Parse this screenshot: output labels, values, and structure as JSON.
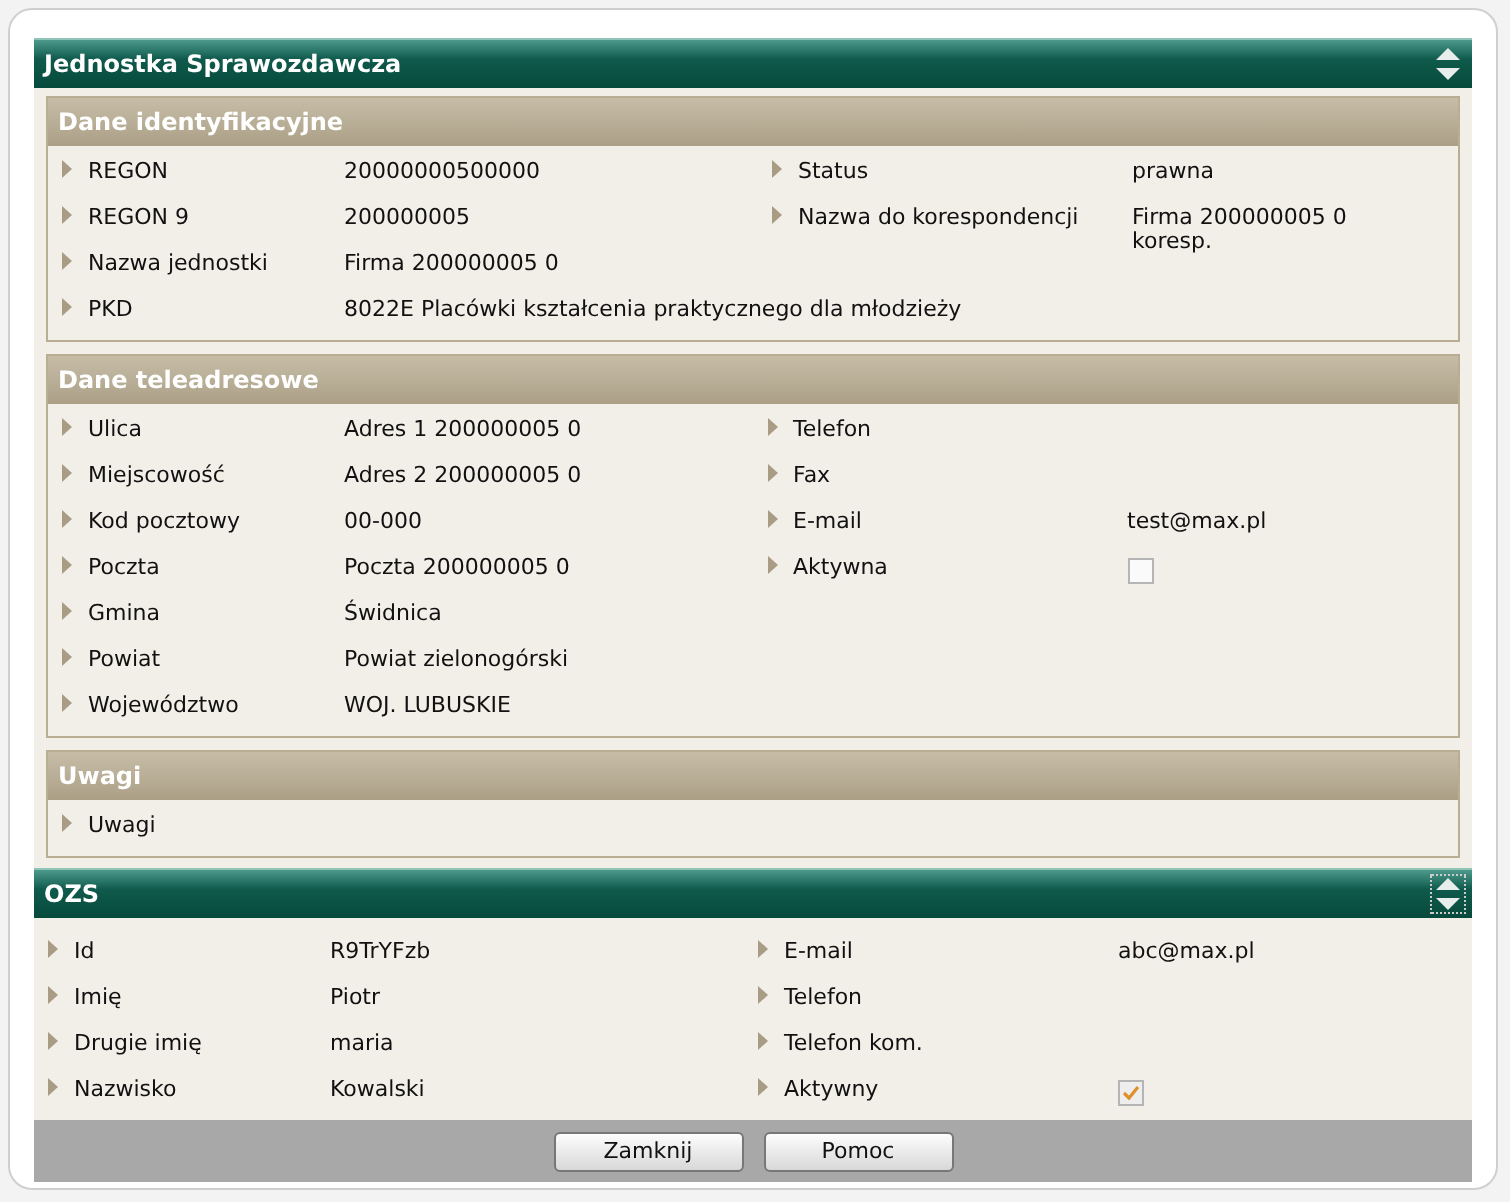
{
  "panels": [
    {
      "title": "Jednostka Sprawozdawcza",
      "sections": [
        {
          "title": "Dane identyfikacyjne",
          "left": [
            {
              "kind": "text",
              "label": "REGON",
              "value": "20000000500000"
            },
            {
              "kind": "text",
              "label": "REGON 9",
              "value": "200000005"
            },
            {
              "kind": "text",
              "label": "Nazwa jednostki",
              "value": "Firma 200000005 0"
            },
            {
              "kind": "text",
              "label": "PKD",
              "value": "8022E Placówki kształcenia praktycznego dla młodzieży"
            }
          ],
          "right": [
            {
              "kind": "text",
              "label": "Status",
              "value": "prawna"
            },
            {
              "kind": "text",
              "label": "Nazwa do korespondencji",
              "value": "Firma 200000005 0 koresp."
            }
          ]
        },
        {
          "title": "Dane teleadresowe",
          "left": [
            {
              "kind": "text",
              "label": "Ulica",
              "value": "Adres 1 200000005 0"
            },
            {
              "kind": "text",
              "label": "Miejscowość",
              "value": "Adres 2 200000005 0"
            },
            {
              "kind": "text",
              "label": "Kod pocztowy",
              "value": "00-000"
            },
            {
              "kind": "text",
              "label": "Poczta",
              "value": "Poczta 200000005 0"
            },
            {
              "kind": "text",
              "label": "Gmina",
              "value": "Świdnica"
            },
            {
              "kind": "text",
              "label": "Powiat",
              "value": "Powiat zielonogórski"
            },
            {
              "kind": "text",
              "label": "Województwo",
              "value": "WOJ. LUBUSKIE"
            }
          ],
          "right": [
            {
              "kind": "text",
              "label": "Telefon"
            },
            {
              "kind": "text",
              "label": "Fax"
            },
            {
              "kind": "text",
              "label": "E-mail",
              "value": "test@max.pl"
            },
            {
              "kind": "checkbox",
              "label": "Aktywna",
              "checked": false
            }
          ]
        },
        {
          "title": "Uwagi",
          "left": [
            {
              "kind": "text",
              "label": "Uwagi"
            }
          ]
        }
      ]
    },
    {
      "title": "OZS",
      "sections": [
        {
          "left": [
            {
              "kind": "text",
              "label": "Id",
              "value": "R9TrYFzb"
            },
            {
              "kind": "text",
              "label": "Imię",
              "value": "Piotr"
            },
            {
              "kind": "text",
              "label": "Drugie imię",
              "value": "maria"
            },
            {
              "kind": "text",
              "label": "Nazwisko",
              "value": "Kowalski"
            }
          ],
          "right": [
            {
              "kind": "text",
              "label": "E-mail",
              "value": "abc@max.pl"
            },
            {
              "kind": "text",
              "label": "Telefon"
            },
            {
              "kind": "text",
              "label": "Telefon kom."
            },
            {
              "kind": "checkbox",
              "label": "Aktywny",
              "checked": true
            }
          ]
        }
      ]
    }
  ],
  "buttons": [
    "Zamknij",
    "Pomoc"
  ]
}
